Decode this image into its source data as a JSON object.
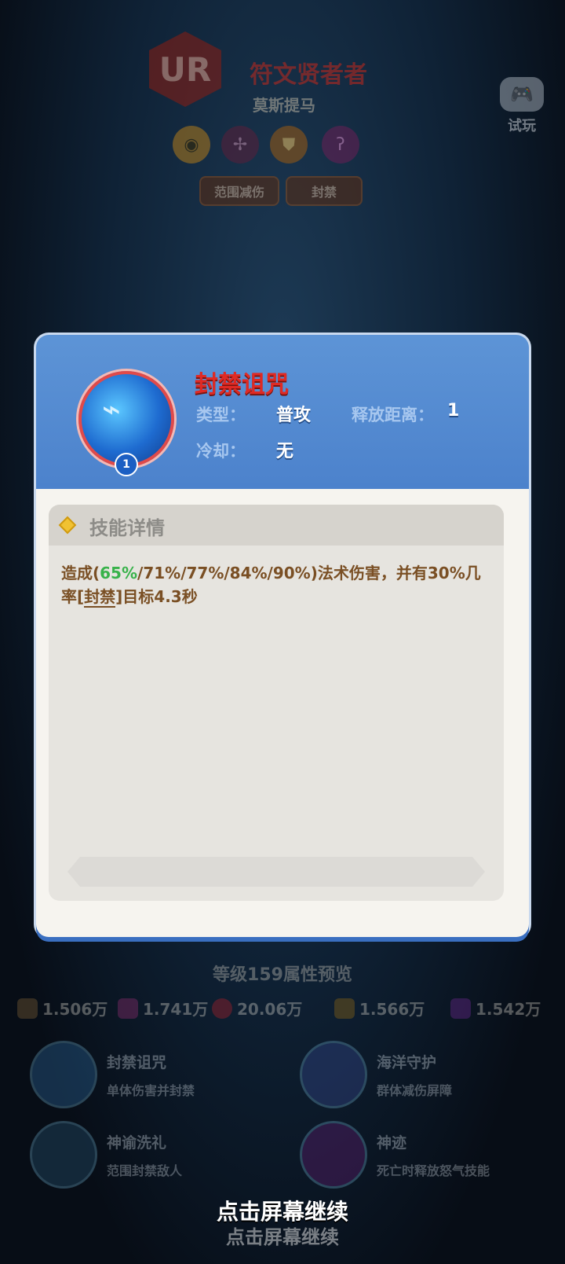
{
  "hero": {
    "rarity": "UR",
    "title": "符文贤者者",
    "subtitle": "莫斯提马",
    "attr_icons": [
      "eye-icon",
      "staff-icon",
      "shield-icon",
      "rune-icon"
    ],
    "tags": [
      "范围减伤",
      "封禁"
    ],
    "try_label": "试玩"
  },
  "skill": {
    "name": "封禁诅咒",
    "level": "1",
    "type_label": "类型：",
    "type_value": "普攻",
    "range_label": "释放距离：",
    "range_value": "1",
    "cooldown_label": "冷却：",
    "cooldown_value": "无",
    "detail_title": "技能详情",
    "desc": {
      "p1": "造成(",
      "highlight": "65%",
      "p2": "/71%/77%/84%/90%)法术伤害，并有30%几率[",
      "keyword": "封禁",
      "p3": "]目标4.3秒"
    }
  },
  "preview": {
    "title": "等级159属性预览",
    "stats": [
      {
        "icon": "sword-icon",
        "value": "1.506万"
      },
      {
        "icon": "wand-icon",
        "value": "1.741万"
      },
      {
        "icon": "heart-icon",
        "value": "20.06万"
      },
      {
        "icon": "shield-icon",
        "value": "1.566万"
      },
      {
        "icon": "cloak-icon",
        "value": "1.542万"
      }
    ],
    "skills": [
      {
        "name": "封禁诅咒",
        "desc": "单体伤害并封禁"
      },
      {
        "name": "海洋守护",
        "desc": "群体减伤屏障"
      },
      {
        "name": "神谕洗礼",
        "desc": "范围封禁敌人"
      },
      {
        "name": "神迹",
        "desc": "死亡时释放怒气技能"
      }
    ]
  },
  "continue_text": "点击屏幕继续",
  "colors": {
    "modal_header": "#4c82cc",
    "skill_name": "#e02a24",
    "highlight": "#38b24a",
    "desc_text": "#7a4f24"
  }
}
